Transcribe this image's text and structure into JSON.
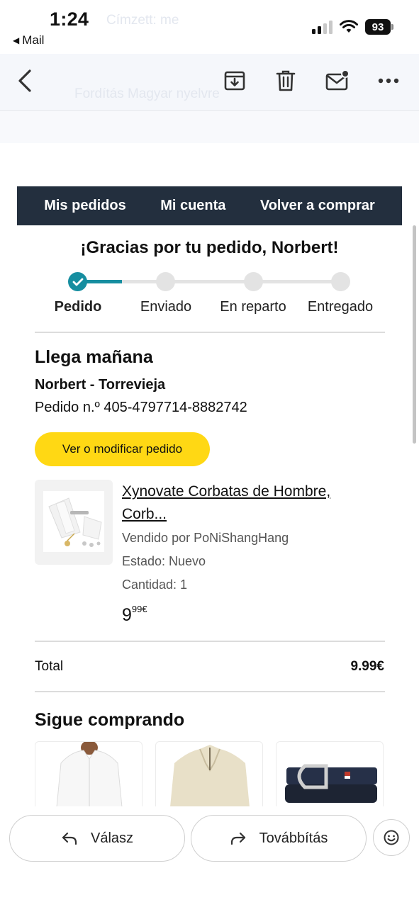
{
  "status_bar": {
    "time": "1:24",
    "back_app": "Mail",
    "battery": "93"
  },
  "background_overlay": {
    "sender_hint": "Címzett: me",
    "translate_hint": "Fordítás Magyar nyelvre"
  },
  "toolbar": {
    "icons": [
      "back-chevron-icon",
      "archive-icon",
      "trash-icon",
      "mark-unread-icon",
      "more-icon"
    ]
  },
  "email": {
    "nav": [
      "Mis pedidos",
      "Mi cuenta",
      "Volver a comprar"
    ],
    "thanks": "¡Gracias por tu pedido, Norbert!",
    "steps": [
      "Pedido",
      "Enviado",
      "En reparto",
      "Entregado"
    ],
    "current_step": 0,
    "arrival": "Llega mañana",
    "address": "Norbert - Torrevieja",
    "order_number": "Pedido n.º 405-4797714-8882742",
    "cta": "Ver o modificar pedido",
    "product": {
      "title": "Xynovate Corbatas de Hombre, Corb...",
      "seller": "Vendido por PoNiShangHang",
      "condition": "Estado: Nuevo",
      "quantity": "Cantidad: 1",
      "price_whole": "9",
      "price_fraction": "99€"
    },
    "total_label": "Total",
    "total_value": "9.99€",
    "keep_shopping": "Sigue comprando",
    "recommendations": [
      "white-shirt",
      "beige-sweater",
      "black-belt"
    ]
  },
  "reply_bar": {
    "reply": "Válasz",
    "forward": "Továbbítás"
  },
  "colors": {
    "nav_bg": "#232f3e",
    "accent_teal": "#168ea0",
    "cta_yellow": "#ffd814"
  }
}
